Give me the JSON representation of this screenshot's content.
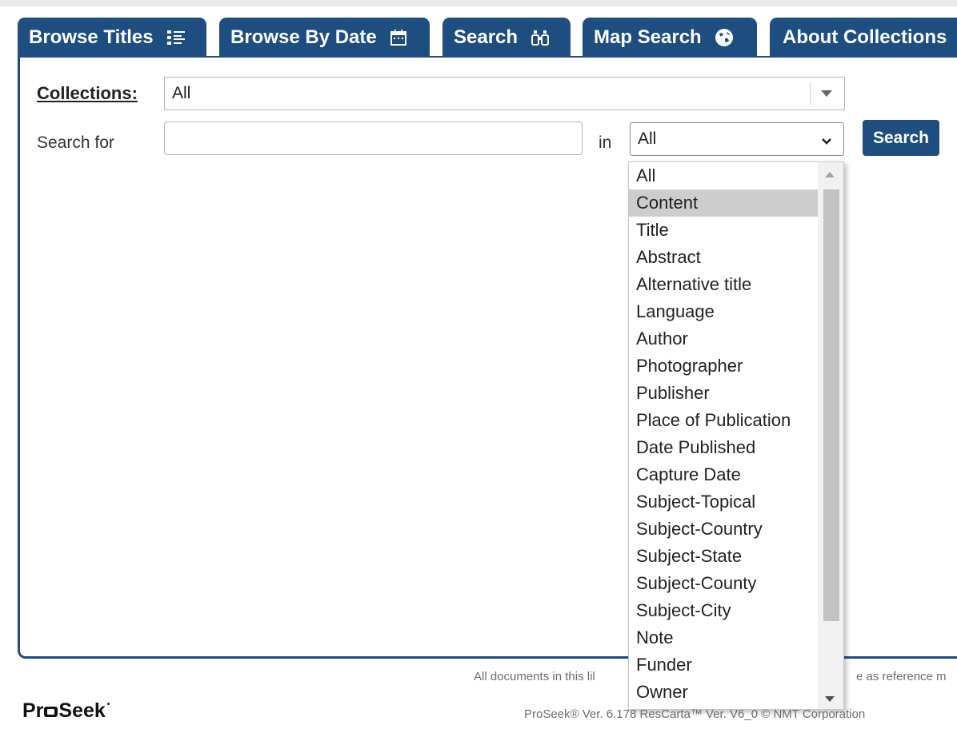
{
  "tabs": [
    {
      "label": "Browse Titles",
      "icon": "list-icon"
    },
    {
      "label": "Browse By Date",
      "icon": "calendar-icon"
    },
    {
      "label": "Search",
      "icon": "binoculars-icon"
    },
    {
      "label": "Map Search",
      "icon": "globe-icon"
    },
    {
      "label": "About Collections",
      "icon": ""
    }
  ],
  "form": {
    "collections_label": "Collections:",
    "collections_value": "All",
    "search_for_label": "Search for",
    "search_value": "",
    "in_label": "in",
    "field_value": "All",
    "search_button": "Search"
  },
  "dropdown": {
    "options": [
      "All",
      "Content",
      "Title",
      "Abstract",
      "Alternative title",
      "Language",
      "Author",
      "Photographer",
      "Publisher",
      "Place of Publication",
      "Date Published",
      "Capture Date",
      "Subject-Topical",
      "Subject-Country",
      "Subject-State",
      "Subject-County",
      "Subject-City",
      "Note",
      "Funder",
      "Owner"
    ],
    "highlighted": "Content"
  },
  "footer": {
    "notice_left": "All documents in this lil",
    "notice_right": "e as reference m",
    "logo": "ProSeek",
    "version": "ProSeek® Ver. 6.178 ResCarta™ Ver. V6_0 © NMT Corporation"
  },
  "colors": {
    "accent": "#1e4d80",
    "highlight": "#cdcdcd"
  }
}
